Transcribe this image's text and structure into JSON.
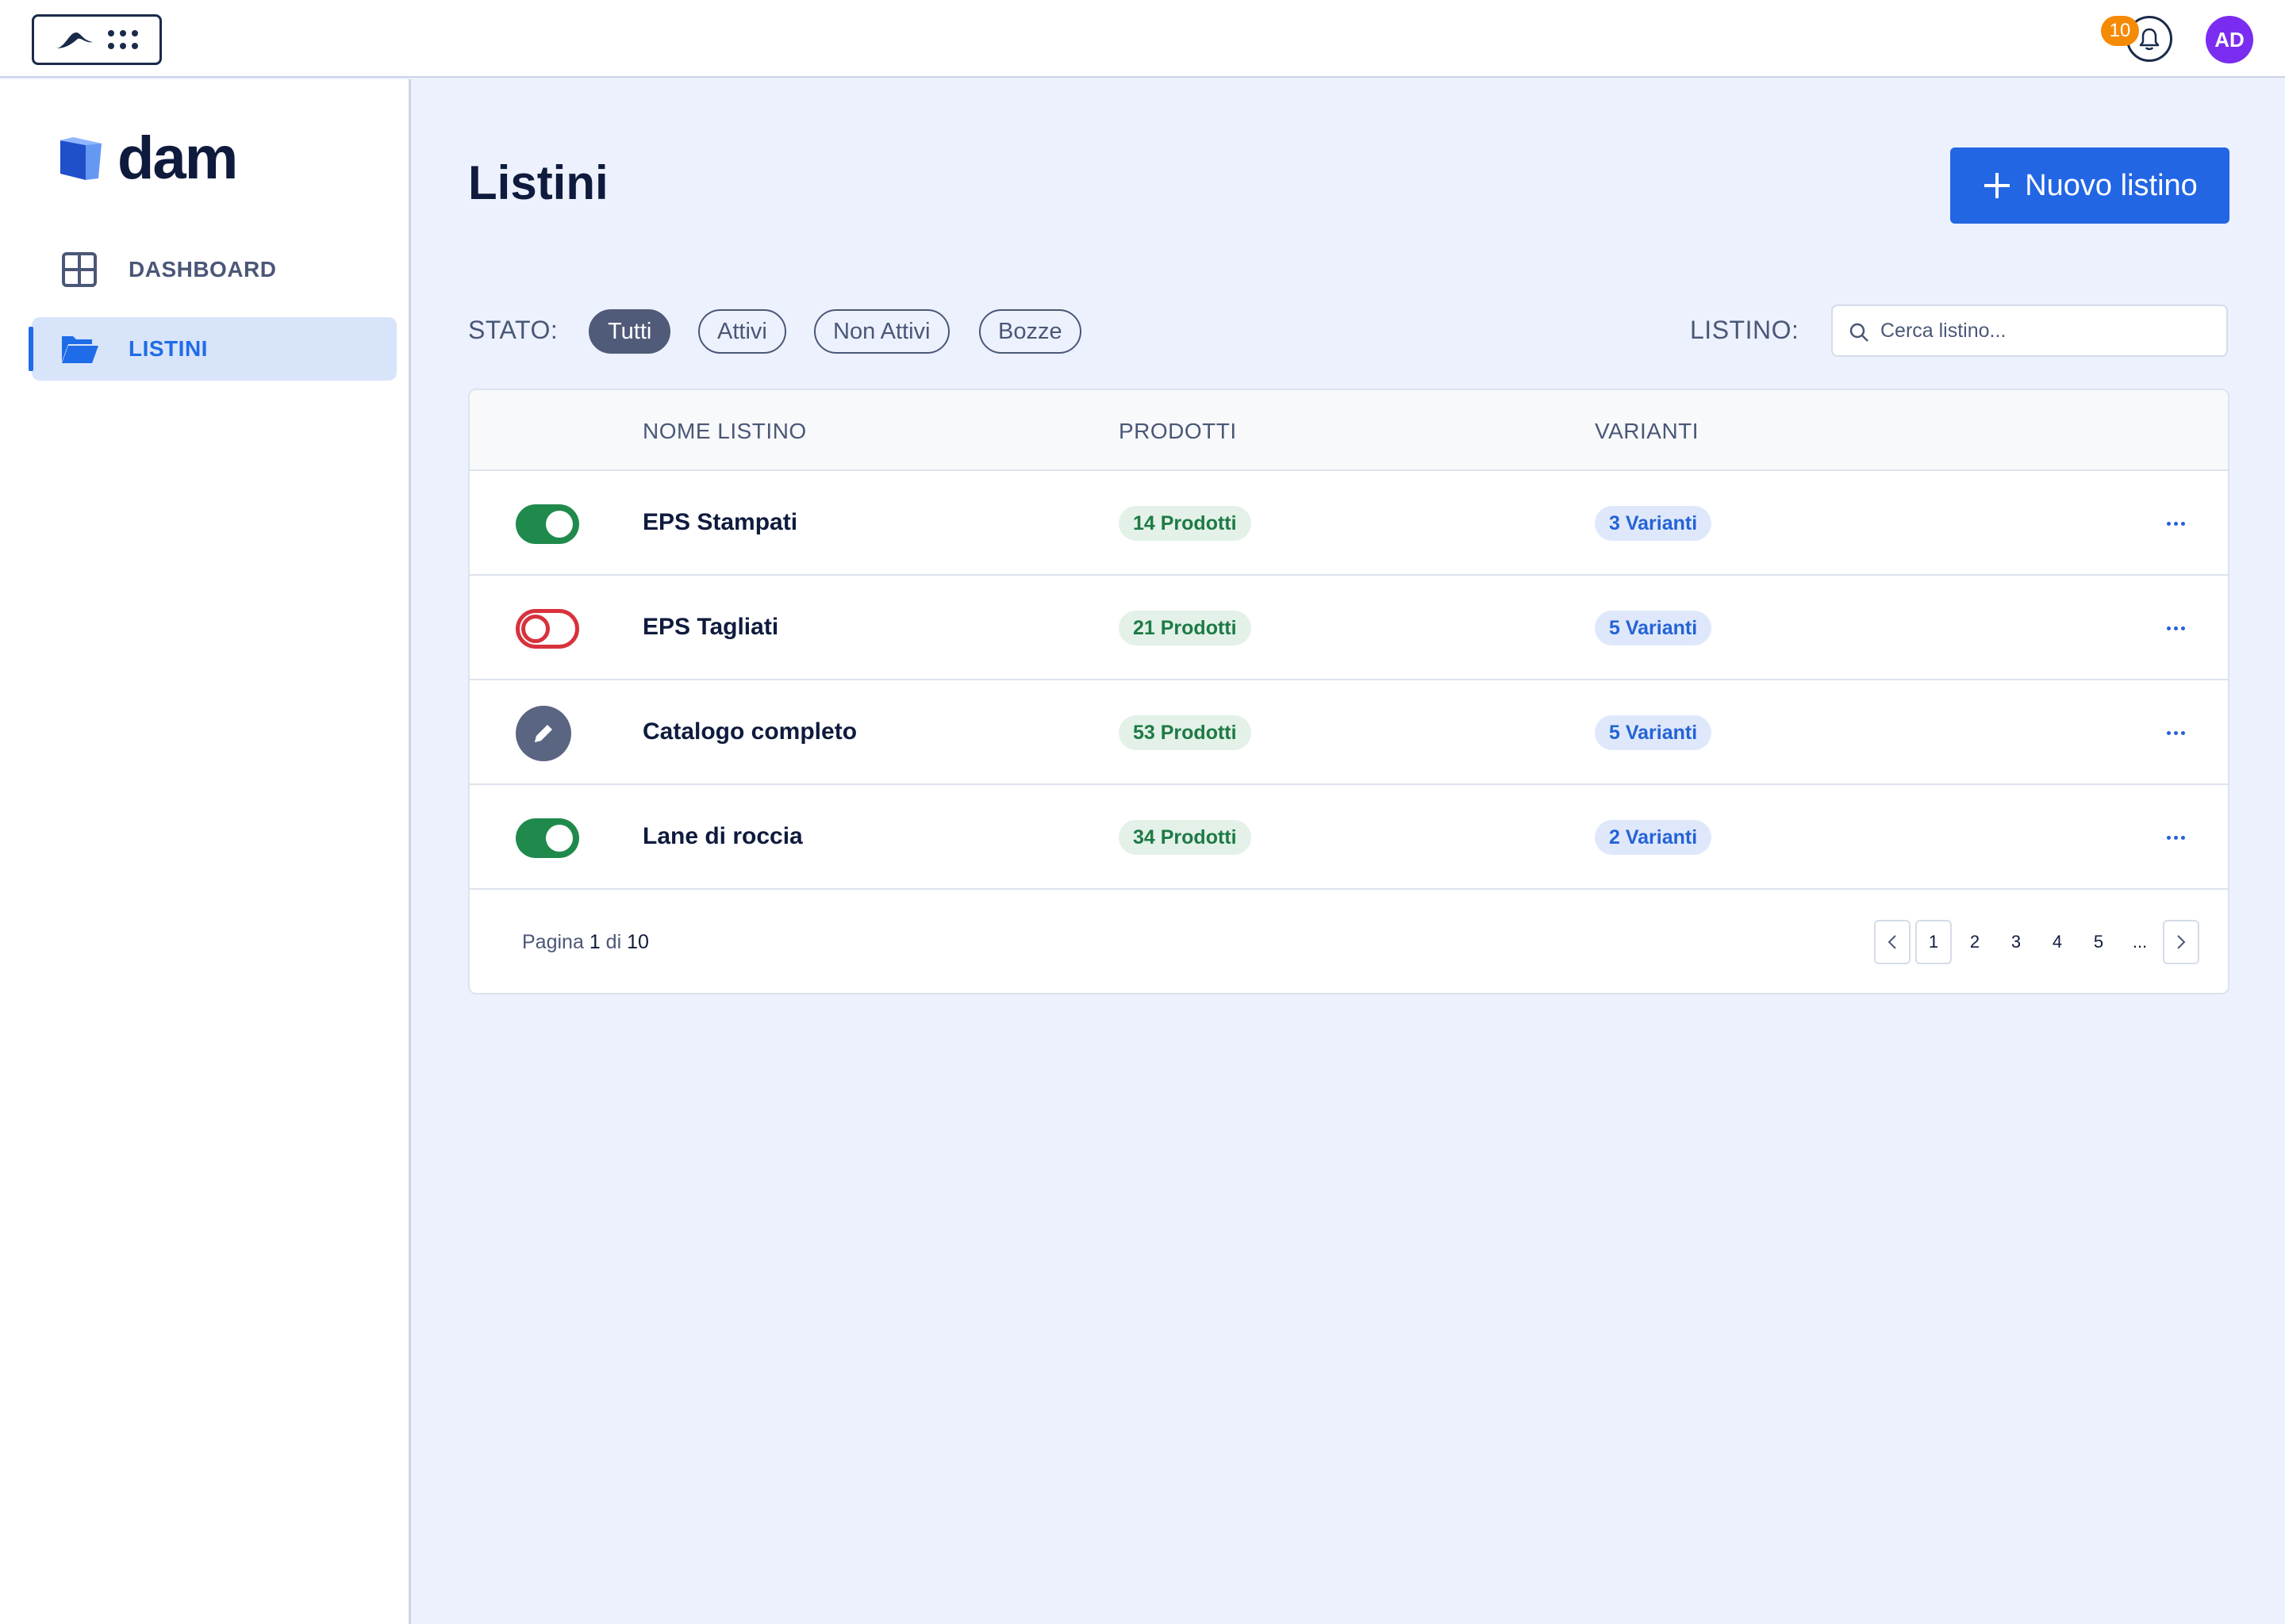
{
  "topbar": {
    "notifications_count": "10",
    "avatar_initials": "AD"
  },
  "brand": {
    "name": "dam"
  },
  "sidebar": {
    "items": [
      {
        "label": "DASHBOARD",
        "icon": "dashboard-grid-icon",
        "active": false
      },
      {
        "label": "LISTINI",
        "icon": "folder-open-icon",
        "active": true
      }
    ]
  },
  "page": {
    "title": "Listini",
    "new_button_label": "Nuovo listino"
  },
  "filters": {
    "status_label": "STATO:",
    "chips": [
      "Tutti",
      "Attivi",
      "Non Attivi",
      "Bozze"
    ],
    "active_chip": "Tutti",
    "search_label": "LISTINO:",
    "search_placeholder": "Cerca listino..."
  },
  "table": {
    "columns": [
      "NOME LISTINO",
      "PRODOTTI",
      "VARIANTI"
    ],
    "rows": [
      {
        "status": "active",
        "name": "EPS Stampati",
        "products": "14 Prodotti",
        "variants": "3 Varianti"
      },
      {
        "status": "inactive",
        "name": "EPS Tagliati",
        "products": "21 Prodotti",
        "variants": "5 Varianti"
      },
      {
        "status": "draft",
        "name": "Catalogo completo",
        "products": "53 Prodotti",
        "variants": "5 Varianti"
      },
      {
        "status": "active",
        "name": "Lane di roccia",
        "products": "34 Prodotti",
        "variants": "2 Varianti"
      }
    ]
  },
  "pagination": {
    "prefix": "Pagina",
    "current": "1",
    "separator": "di",
    "total": "10",
    "pages": [
      "1",
      "2",
      "3",
      "4",
      "5",
      "..."
    ]
  },
  "colors": {
    "primary": "#2266e3",
    "active_toggle": "#1f8a4c",
    "inactive_toggle": "#d8323c",
    "badge": "#f58a07",
    "avatar": "#7a2cf0"
  }
}
